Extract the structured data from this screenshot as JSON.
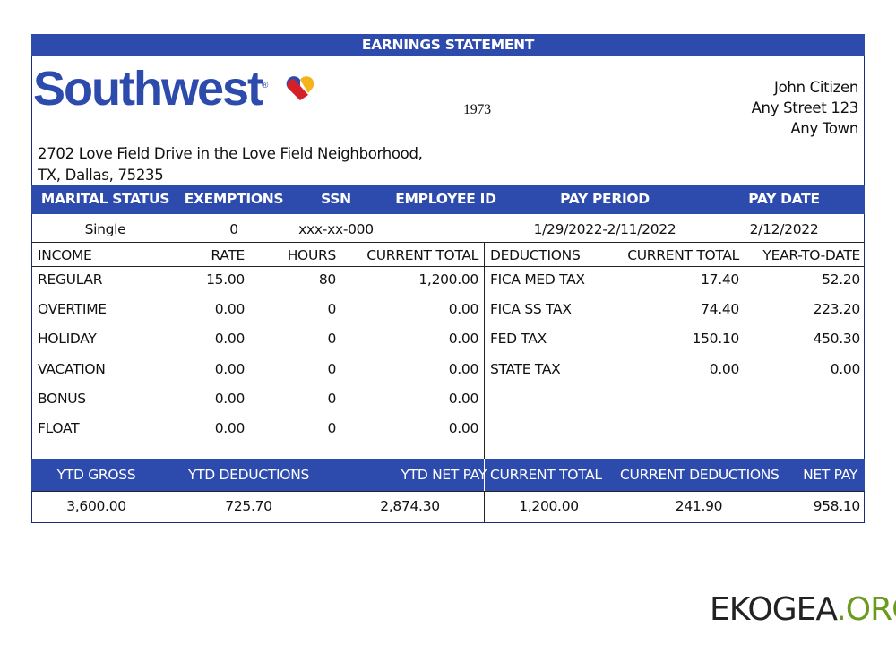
{
  "title": "EARNINGS STATEMENT",
  "company": {
    "logo_text": "Southwest",
    "year": "1973",
    "address_line1": "2702 Love Field Drive in the Love Field Neighborhood,",
    "address_line2": "TX, Dallas, 75235"
  },
  "employee": {
    "name": "John Citizen",
    "street": "Any Street 123",
    "town": "Any Town"
  },
  "info_headers": [
    "MARITAL STATUS",
    "EXEMPTIONS",
    "SSN",
    "EMPLOYEE ID",
    "PAY PERIOD",
    "PAY DATE"
  ],
  "info_values": {
    "marital_status": "Single",
    "exemptions": "0",
    "ssn": "xxx-xx-000",
    "employee_id": "",
    "pay_period": "1/29/2022-2/11/2022",
    "pay_date": "2/12/2022"
  },
  "income_headers": [
    "INCOME",
    "RATE",
    "HOURS",
    "CURRENT TOTAL"
  ],
  "income": [
    {
      "name": "REGULAR",
      "rate": "15.00",
      "hours": "80",
      "total": "1,200.00"
    },
    {
      "name": "OVERTIME",
      "rate": "0.00",
      "hours": "0",
      "total": "0.00"
    },
    {
      "name": "HOLIDAY",
      "rate": "0.00",
      "hours": "0",
      "total": "0.00"
    },
    {
      "name": "VACATION",
      "rate": "0.00",
      "hours": "0",
      "total": "0.00"
    },
    {
      "name": "BONUS",
      "rate": "0.00",
      "hours": "0",
      "total": "0.00"
    },
    {
      "name": "FLOAT",
      "rate": "0.00",
      "hours": "0",
      "total": "0.00"
    }
  ],
  "deduction_headers": [
    "DEDUCTIONS",
    "CURRENT TOTAL",
    "YEAR-TO-DATE"
  ],
  "deductions": [
    {
      "name": "FICA MED TAX",
      "current": "17.40",
      "ytd": "52.20"
    },
    {
      "name": "FICA SS TAX",
      "current": "74.40",
      "ytd": "223.20"
    },
    {
      "name": "FED TAX",
      "current": "150.10",
      "ytd": "450.30"
    },
    {
      "name": "STATE TAX",
      "current": "0.00",
      "ytd": "0.00"
    }
  ],
  "summary_headers": [
    "YTD GROSS",
    "YTD DEDUCTIONS",
    "YTD NET PAY",
    "CURRENT TOTAL",
    "CURRENT DEDUCTIONS",
    "NET PAY"
  ],
  "summary_values": [
    "3,600.00",
    "725.70",
    "2,874.30",
    "1,200.00",
    "241.90",
    "958.10"
  ],
  "watermark": {
    "main": "EKOGEA",
    "suffix": ".ORG",
    "suffix_color": "#6a9a1f"
  }
}
